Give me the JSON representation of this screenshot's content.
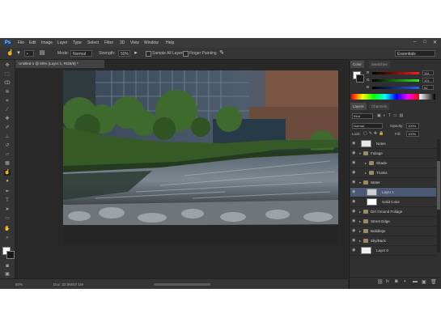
{
  "app": {
    "logo": "Ps"
  },
  "menu": [
    "File",
    "Edit",
    "Image",
    "Layer",
    "Type",
    "Select",
    "Filter",
    "3D",
    "View",
    "Window",
    "Help"
  ],
  "window_controls": [
    "–",
    "□",
    "✕"
  ],
  "options": {
    "mode_label": "Mode:",
    "mode_value": "Normal",
    "strength_label": "Strength:",
    "strength_value": "50%",
    "sample_all": "Sample All Layers",
    "finger_painting": "Finger Painting",
    "workspace": "Essentials"
  },
  "document": {
    "tab_title": "Untitled-1 @ 50% (Layer 1, RGB/8) *"
  },
  "status": {
    "zoom": "50%",
    "doc": "Doc: 22.0M/67.1M"
  },
  "panels": {
    "color_tab": "Color",
    "swatches_tab": "Swatches",
    "rgb": [
      {
        "label": "R",
        "value": "114"
      },
      {
        "label": "G",
        "value": "101"
      },
      {
        "label": "B",
        "value": "92"
      }
    ],
    "layers_tab": "Layers",
    "channels_tab": "Channels",
    "kind": "Kind",
    "blend": "Normal",
    "opacity_label": "Opacity:",
    "opacity": "100%",
    "lock_label": "Lock:",
    "fill_label": "Fill:",
    "fill": "100%"
  },
  "layers": [
    {
      "name": "Notes",
      "indent": 0,
      "type": "layer",
      "thumb": "#e8e8e8",
      "selected": false
    },
    {
      "name": "Foliage",
      "indent": 0,
      "type": "group",
      "selected": false
    },
    {
      "name": "Shade",
      "indent": 1,
      "type": "group",
      "selected": false
    },
    {
      "name": "Trunks",
      "indent": 1,
      "type": "group",
      "selected": false
    },
    {
      "name": "Water",
      "indent": 0,
      "type": "group",
      "selected": false
    },
    {
      "name": "Layer 1",
      "indent": 1,
      "type": "layer",
      "thumb": "#cfcfcf",
      "selected": true
    },
    {
      "name": "Solid Color",
      "indent": 1,
      "type": "layer",
      "thumb": "#ffffff",
      "selected": false
    },
    {
      "name": "Dirt Ground Foliage",
      "indent": 0,
      "type": "group",
      "selected": false
    },
    {
      "name": "Street Edge",
      "indent": 0,
      "type": "group",
      "selected": false
    },
    {
      "name": "Buildings",
      "indent": 0,
      "type": "group",
      "selected": false
    },
    {
      "name": "Sky/Back",
      "indent": 0,
      "type": "group",
      "selected": false
    },
    {
      "name": "Layer 0",
      "indent": 0,
      "type": "layer",
      "thumb": "#f0f0f0",
      "selected": false
    }
  ],
  "colors": {
    "fg": "#ffffff",
    "bg": "#1a1a1a",
    "selection": "#4b5a72"
  },
  "icons": [
    "smudge-tool-icon",
    "move-tool-icon",
    "marquee-tool-icon",
    "lasso-tool-icon",
    "quick-select-icon",
    "crop-icon",
    "eyedropper-icon",
    "heal-icon",
    "brush-icon",
    "stamp-icon",
    "history-brush-icon",
    "eraser-icon",
    "gradient-icon",
    "smudge-icon",
    "dodge-icon",
    "pen-icon",
    "type-icon",
    "path-select-icon",
    "shape-icon",
    "hand-icon",
    "zoom-icon"
  ]
}
